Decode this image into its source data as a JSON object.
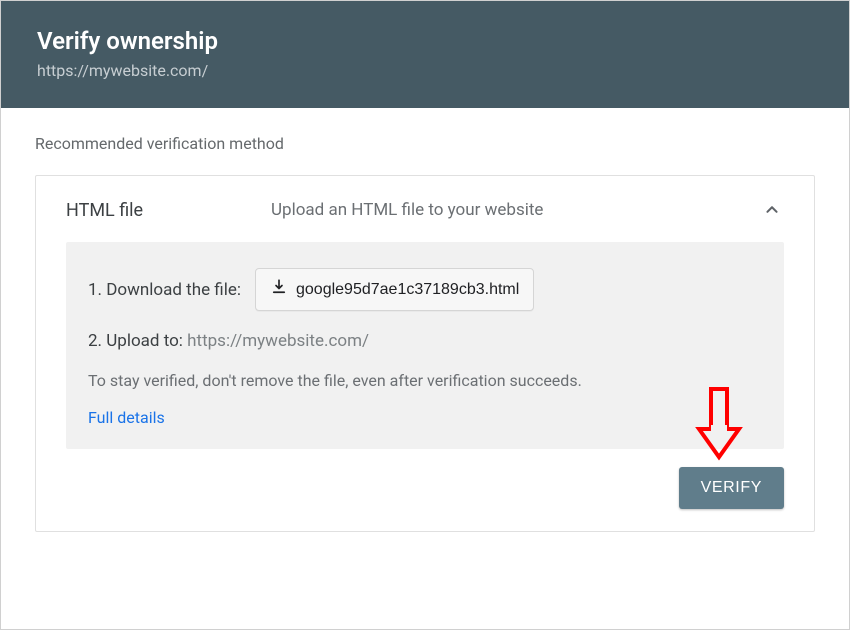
{
  "header": {
    "title": "Verify ownership",
    "subtitle": "https://mywebsite.com/"
  },
  "section_label": "Recommended verification method",
  "card": {
    "title": "HTML file",
    "description": "Upload an HTML file to your website"
  },
  "steps": {
    "step1_label": "1. Download the file:",
    "download_filename": "google95d7ae1c37189cb3.html",
    "step2_label": "2. Upload to: ",
    "upload_url": "https://mywebsite.com/",
    "note": "To stay verified, don't remove the file, even after verification succeeds.",
    "details_link": "Full details"
  },
  "actions": {
    "verify_label": "VERIFY"
  }
}
